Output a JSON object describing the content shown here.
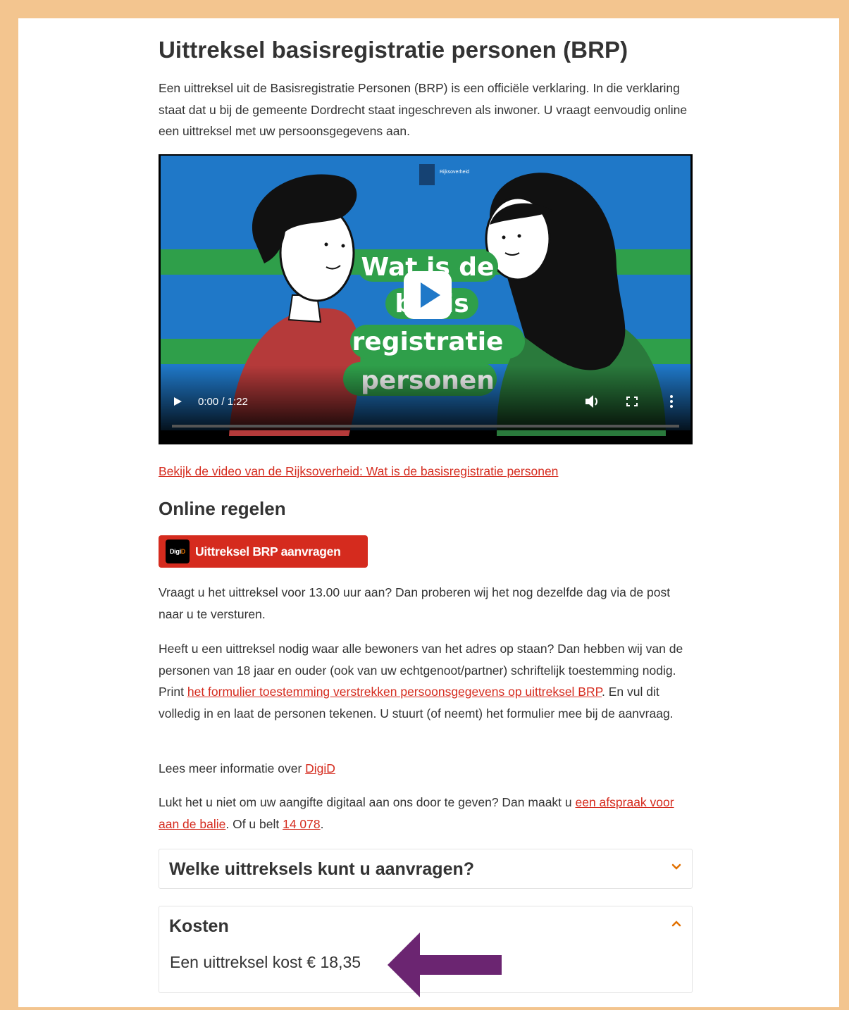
{
  "page": {
    "title": "Uittreksel basisregistratie personen (BRP)",
    "intro": "Een uittreksel uit de Basisregistratie Personen (BRP) is een officiële verklaring. In die verklaring staat dat u bij de gemeente Dordrecht staat ingeschreven als inwoner. U vraagt eenvoudig online een uittreksel met uw persoonsgegevens aan."
  },
  "video": {
    "overlay_lines": [
      "Wat is de",
      "basis",
      "registratie",
      "personen"
    ],
    "logo_text": "Rijksoverheid",
    "time": "0:00 / 1:22",
    "progress": 0
  },
  "rijks_link": "Bekijk de video van de Rijksoverheid: Wat is de basisregistratie personen",
  "online": {
    "heading": "Online regelen",
    "button_label": "Uittreksel BRP aanvragen",
    "button_logo": "DigiD"
  },
  "para1": "Vraagt u het uittreksel voor 13.00 uur aan? Dan proberen wij het nog dezelfde dag via de post naar u te versturen.",
  "para2": {
    "before": "Heeft u een uittreksel nodig waar alle bewoners van het adres op staan? Dan hebben wij van de personen van 18 jaar en ouder (ook van uw echtgenoot/partner) schriftelijk toestemming nodig. Print ",
    "link": "het formulier toestemming verstrekken persoonsgegevens op uittreksel BRP",
    "after": ". En vul dit volledig in en laat de personen tekenen. U stuurt (of neemt) het formulier mee bij de aanvraag."
  },
  "para3": {
    "before": "Lees meer informatie over ",
    "link": "DigiD"
  },
  "para4": {
    "before": "Lukt het u niet om uw aangifte digitaal aan ons door te geven? Dan maakt u ",
    "link": "een afspraak voor aan de balie",
    "middle": ". Of u belt ",
    "phone": "14 078",
    "after": "."
  },
  "accordion": [
    {
      "title": "Welke uittreksels kunt u aanvragen?",
      "expanded": false
    },
    {
      "title": "Kosten",
      "expanded": true,
      "body": "Een uittreksel kost € 18,35"
    }
  ],
  "colors": {
    "border": "#f3c58f",
    "link": "#d52b1e",
    "button": "#d52b1e",
    "arrow": "#6b2571",
    "chevron": "#e17000"
  }
}
